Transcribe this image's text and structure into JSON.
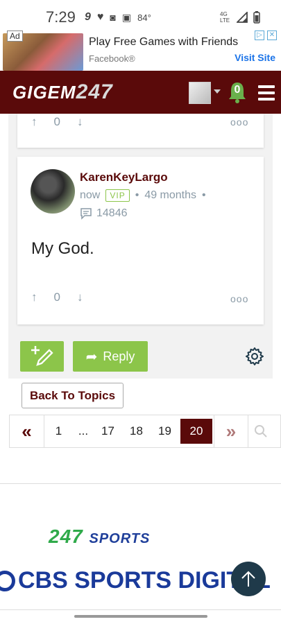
{
  "status": {
    "time": "7:29",
    "temp": "84°",
    "network": "4G LTE"
  },
  "ad": {
    "badge": "Ad",
    "title": "Play Free Games with Friends",
    "source": "Facebook®",
    "cta": "Visit Site"
  },
  "header": {
    "logo_text": "GIGEM",
    "logo_num": "247",
    "notifications": "0"
  },
  "prev_post": {
    "votes": "0"
  },
  "post": {
    "username": "KarenKeyLargo",
    "time": "now",
    "badge": "VIP",
    "tenure": "49 months",
    "sep": "•",
    "post_count": "14846",
    "body": "My God.",
    "votes": "0"
  },
  "actions": {
    "reply_label": "Reply",
    "back_label": "Back To Topics"
  },
  "pager": {
    "first": "«",
    "pages": [
      "1",
      "...",
      "17",
      "18",
      "19"
    ],
    "current": "20",
    "next": "»"
  },
  "footer": {
    "brand_247_a": "247",
    "brand_247_b": "SPORTS",
    "brand_cbs": "CBS SPORTS DIGITAL"
  },
  "colors": {
    "maroon": "#5a0a0a",
    "green": "#8cc54a"
  }
}
